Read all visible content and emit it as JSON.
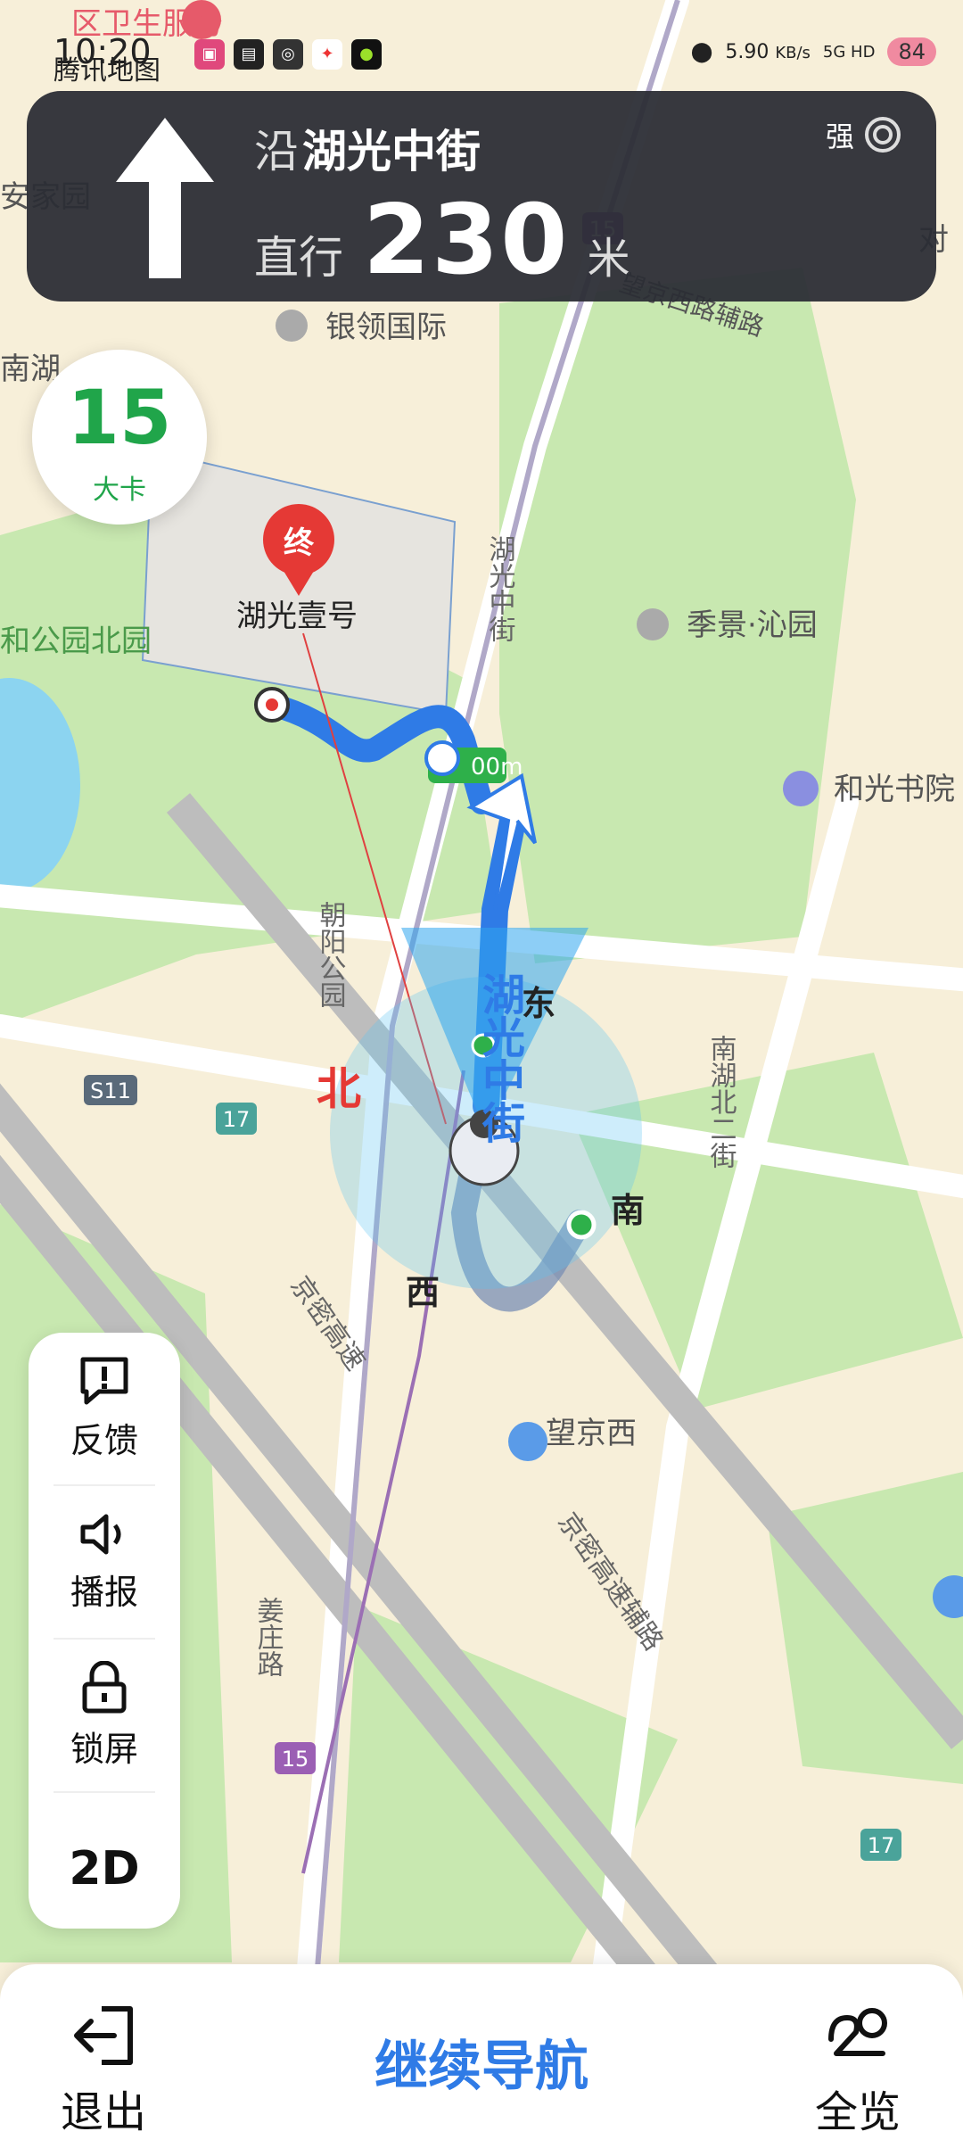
{
  "status_bar": {
    "time": "10:20",
    "net_speed": "5.90",
    "net_unit": "KB/s",
    "network": "5G HD",
    "battery": "84"
  },
  "nav": {
    "prefix": "沿",
    "road": "湖光中街",
    "action": "直行",
    "distance": "230",
    "unit": "米",
    "gps_label": "强"
  },
  "speed": {
    "value": "15",
    "label": "大卡"
  },
  "map": {
    "labels": {
      "tencent_map": "腾讯地图",
      "health_service": "区卫生服务",
      "anjia": "安家园",
      "nanhu": "南湖",
      "yinling": "银领国际",
      "wangjingxilu": "望京西路辅路",
      "destination_marker": "终",
      "destination": "湖光壹号",
      "park_north": "和公园北园",
      "jijing": "季景·沁园",
      "heguang": "和光书院",
      "route_dist": "00m",
      "huguang_street": "湖光中街",
      "chaoyang": "朝阳公园",
      "nanhu_er": "南湖北二街",
      "jiang_zhuang": "姜庄路",
      "wangjing_xi": "望京西",
      "jingmi_fu": "京密高速辅路",
      "jingmi": "京密高速",
      "road_15": "15",
      "road_17": "17",
      "road_s11": "S11",
      "compass_n": "北",
      "compass_e": "东",
      "compass_s": "南",
      "compass_w": "西",
      "right_edge": "对"
    }
  },
  "tools": {
    "feedback": "反馈",
    "broadcast": "播报",
    "lock": "锁屏",
    "view2d": "2D"
  },
  "bottom": {
    "exit": "退出",
    "continue": "继续导航",
    "overview": "全览"
  },
  "colors": {
    "route_blue": "#2f7be6",
    "park_green": "#c8e8b0",
    "road_gray": "#b8b8b8",
    "banner_bg": "#2b2d34",
    "speed_green": "#20a54a"
  }
}
